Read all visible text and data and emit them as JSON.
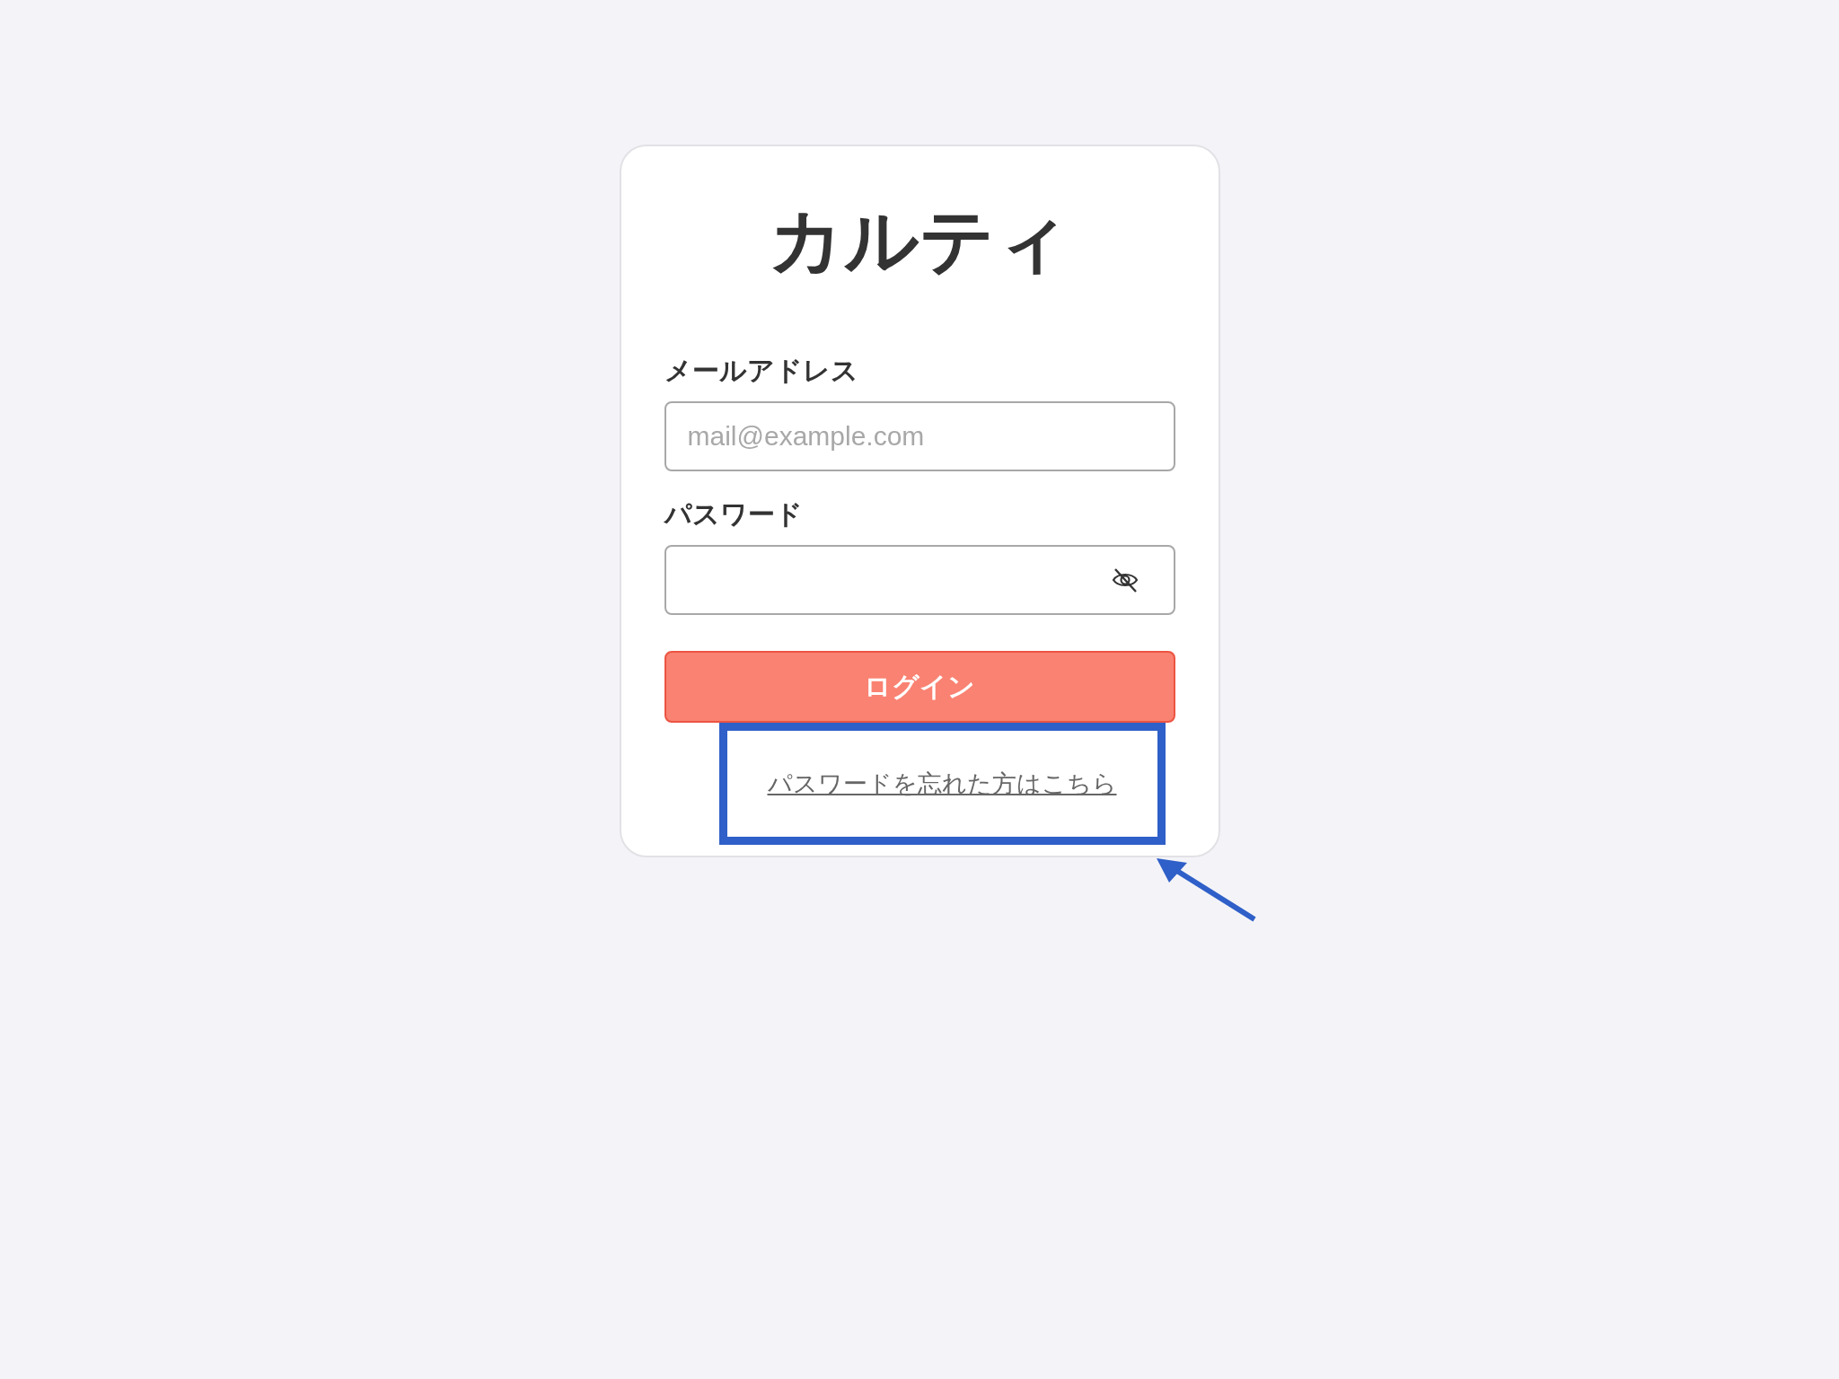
{
  "logo": "カルティ",
  "fields": [
    {
      "label": "メールアドレス",
      "placeholder": "mail@example.com",
      "kind": "email"
    },
    {
      "label": "パスワード",
      "kind": "password",
      "visible": false
    }
  ],
  "login_button": "ログイン",
  "forgot_link": "パスワードを忘れた方はこちら",
  "annotation": {
    "kind": "highlight"
  }
}
